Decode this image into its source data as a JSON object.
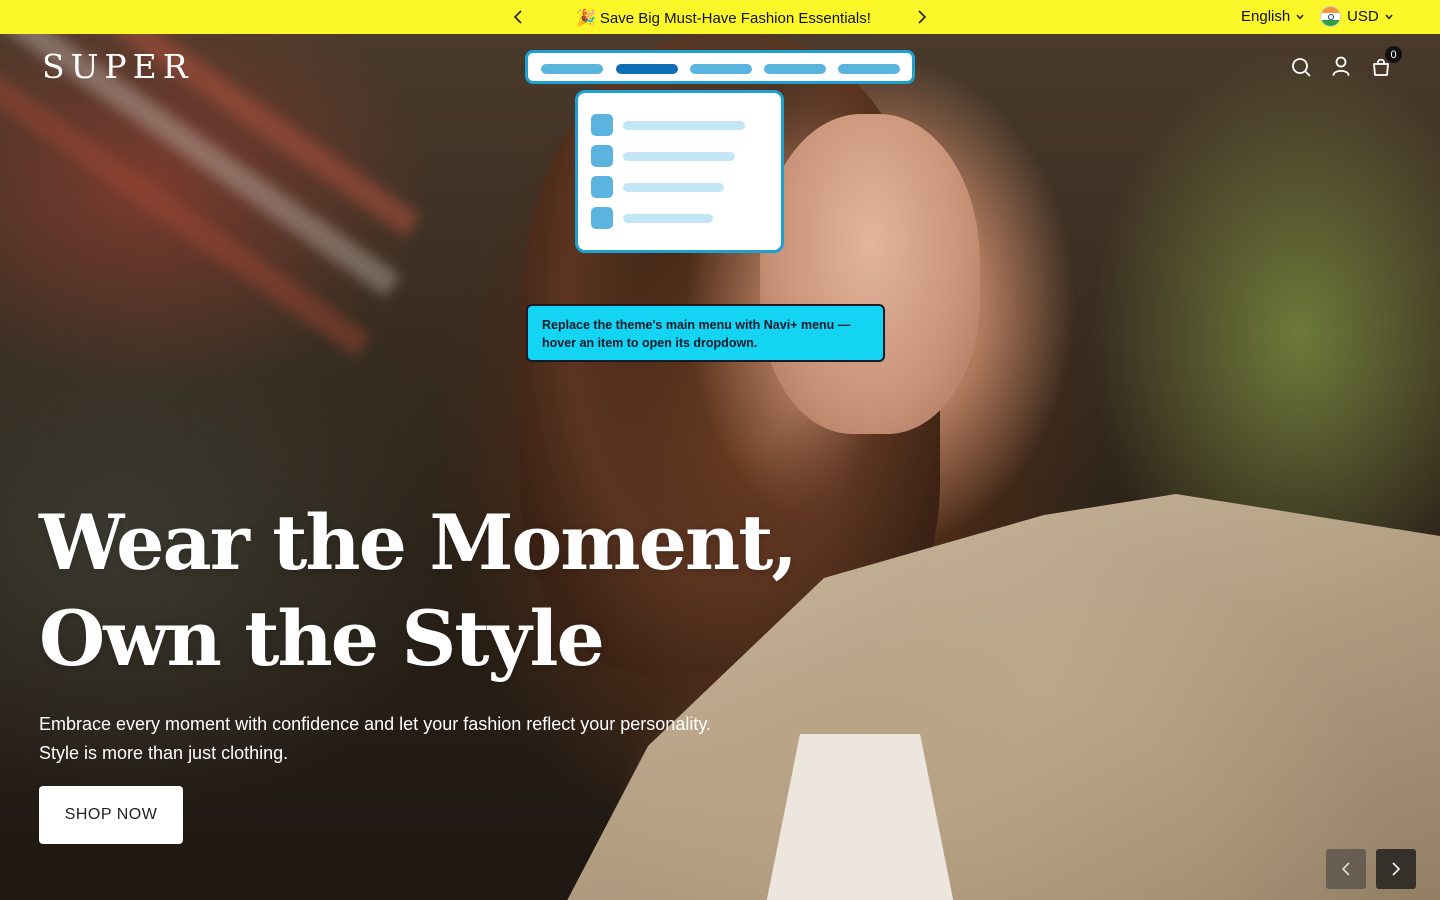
{
  "announcement": {
    "emoji": "🎉",
    "message": "Save Big Must-Have Fashion Essentials!",
    "language": "English",
    "currency": "USD",
    "background": "#fbf728"
  },
  "header": {
    "logo": "SUPER",
    "cart_count": "0",
    "icons": [
      "search-icon",
      "account-icon",
      "cart-icon"
    ]
  },
  "navi_overlay": {
    "menu_items": 5,
    "active_item": 2,
    "dropdown_rows": 4,
    "tooltip": "Replace the theme's main menu with Navi+ menu — hover an item to open its dropdown.",
    "accent": "#1ea0d3",
    "tooltip_bg": "#14d4f4"
  },
  "hero": {
    "headline_line1": "Wear the Moment,",
    "headline_line2": "Own the Style",
    "sub_line1": "Embrace every moment with confidence and let your fashion reflect your personality.",
    "sub_line2": "Style is more than just clothing.",
    "cta": "SHOP NOW"
  }
}
